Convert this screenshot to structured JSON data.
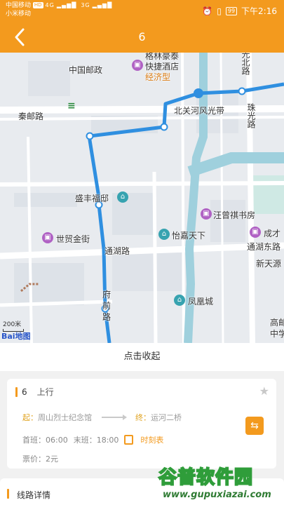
{
  "status_bar": {
    "carrier_1": "中国移动",
    "carrier_1_badge": "HD",
    "carrier_2": "小米移动",
    "signal_1": "4G",
    "signal_2": "3G",
    "battery": "99",
    "time": "下午2:16"
  },
  "app_bar": {
    "title": "6",
    "back_icon": "back-arrow-icon"
  },
  "map": {
    "labels": {
      "post_office": "中国邮政",
      "hotel_1": "格林豪泰",
      "hotel_2": "快捷酒店",
      "hotel_3": "经济型",
      "yiyou_road": "秦邮路",
      "beiguan": "北关河风光带",
      "zhuguang": "珠光路",
      "north_road": "光北路",
      "shengfeng": "盛丰福邸",
      "wangzeng": "汪曾祺书房",
      "shimao": "世贸金街",
      "tonghu": "通湖路",
      "yijia": "怡嘉天下",
      "chengcai": "成才",
      "tonghu_east": "通湖东路",
      "xintian": "新天源",
      "fenghuang": "凤凰城",
      "gaoyou_1": "高邮",
      "gaoyou_2": "中学",
      "fu_road_1": "府",
      "fu_road_2": "前",
      "fu_road_3": "路",
      "scale": "200米",
      "logo_1": "Bai",
      "logo_2": "地图"
    },
    "icons": [
      "post-office-icon",
      "hotel-icon",
      "bus-stop-icon",
      "building-icon"
    ]
  },
  "collapse_label": "点击收起",
  "route_card": {
    "line": "6",
    "direction": "上行",
    "from_label": "起：",
    "from_stop": "周山烈士纪念馆",
    "to_label": "终：",
    "to_stop": "运河二桥",
    "first_label": "首班：",
    "first_time": "06:00",
    "last_label": "末班：",
    "last_time": "18:00",
    "timetable_label": "时刻表",
    "fare_label": "票价：",
    "fare": "2元",
    "accent_color": "#f39a1e"
  },
  "details": {
    "label": "线路详情"
  },
  "watermark": {
    "title": "谷普软件园",
    "url": "www.gupuxiazai.com"
  }
}
